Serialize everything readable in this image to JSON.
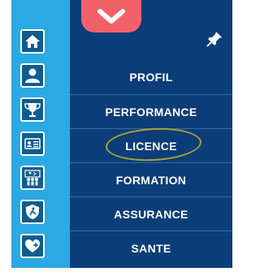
{
  "sidebar": {
    "icons": [
      "home-icon",
      "user-icon",
      "trophy-icon",
      "licence-card-icon",
      "team-icon",
      "insurance-shield-icon",
      "health-heart-icon"
    ]
  },
  "panel": {
    "toggle_icon": "chevron-down-icon",
    "pin_icon": "pin-icon",
    "menu_items": [
      {
        "label": "PROFIL"
      },
      {
        "label": "PERFORMANCE"
      },
      {
        "label": "LICENCE"
      },
      {
        "label": "FORMATION"
      },
      {
        "label": "ASSURANCE"
      },
      {
        "label": "SANTE"
      }
    ]
  },
  "colors": {
    "sidebar": "#2aa9e4",
    "icon_button": "#0f5c8e",
    "panel": "#0b3d79",
    "toggle": "#f2616a",
    "highlight": "#a9a332"
  }
}
